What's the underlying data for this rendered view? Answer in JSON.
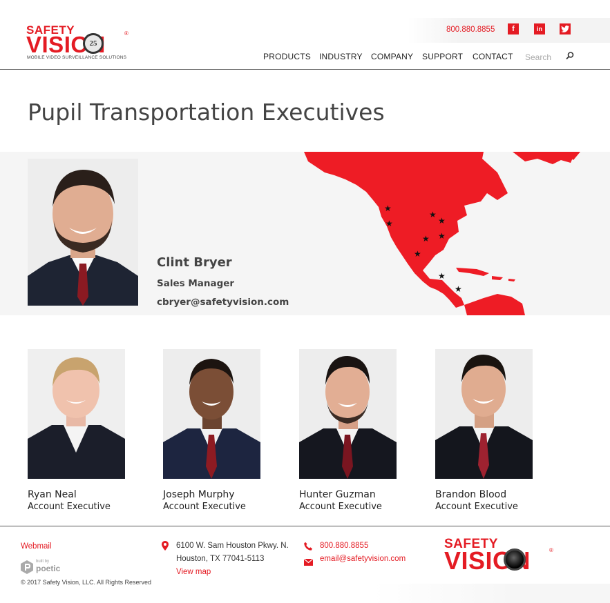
{
  "header": {
    "logo_line1": "SAFETY",
    "logo_line2": "VISION",
    "logo_badge": "25",
    "logo_reg": "®",
    "logo_tagline": "MOBILE VIDEO SURVEILLANCE SOLUTIONS",
    "phone": "800.880.8855",
    "social": [
      {
        "name": "facebook-icon",
        "glyph": "f"
      },
      {
        "name": "linkedin-icon",
        "glyph": "in"
      },
      {
        "name": "twitter-icon",
        "glyph": "t"
      }
    ],
    "nav": [
      "PRODUCTS",
      "INDUSTRY",
      "COMPANY",
      "SUPPORT",
      "CONTACT"
    ],
    "search_placeholder": "Search",
    "accent_color": "#e41b23"
  },
  "page": {
    "title": "Pupil Transportation Executives"
  },
  "manager": {
    "name": "Clint Bryer",
    "role": "Sales Manager",
    "email": "cbryer@safetyvision.com"
  },
  "team": [
    {
      "name": "Ryan Neal",
      "role": "Account Executive"
    },
    {
      "name": "Joseph Murphy",
      "role": "Account Executive"
    },
    {
      "name": "Hunter Guzman",
      "role": "Account Executive"
    },
    {
      "name": "Brandon Blood",
      "role": "Account Executive"
    }
  ],
  "footer": {
    "webmail": "Webmail",
    "built_by_small": "built by",
    "built_by_name": "poetic",
    "copyright": "© 2017 Safety Vision, LLC. All Rights Reserved",
    "address_line1": "6100 W. Sam Houston Pkwy. N.",
    "address_line2": "Houston, TX 77041-5113",
    "view_map": "View map",
    "phone": "800.880.8855",
    "email": "email@safetyvision.com",
    "logo_line1": "SAFETY",
    "logo_line2": "VISION",
    "logo_reg": "®"
  }
}
